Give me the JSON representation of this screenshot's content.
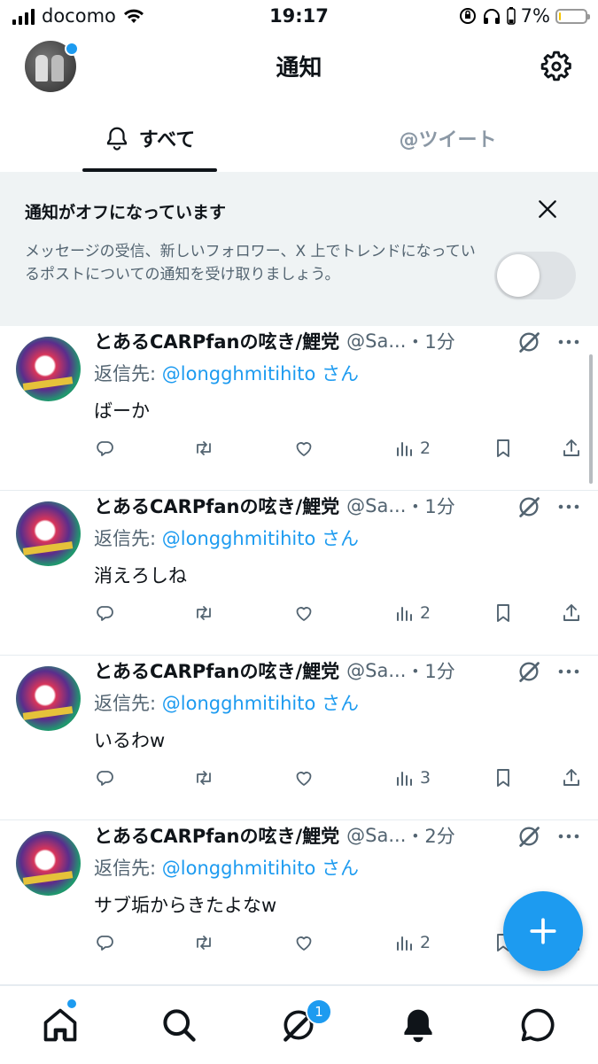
{
  "status_bar": {
    "carrier": "docomo",
    "time": "19:17",
    "battery": "7%",
    "battery_level": 0.07
  },
  "header": {
    "title": "通知"
  },
  "tabs": [
    {
      "label": "すべて",
      "active": true
    },
    {
      "label": "@ツイート",
      "active": false
    }
  ],
  "banner": {
    "title": "通知がオフになっています",
    "body": "メッセージの受信、新しいフォロワー、X 上でトレンドになっているポストについての通知を受け取りましょう。",
    "toggle_on": false
  },
  "posts": [
    {
      "name": "とあるCARPfanの呟き/鯉党",
      "handle": "@Sa...",
      "time": "・1分",
      "reply_prefix": "返信先: ",
      "reply_to": "@longghmitihito さん",
      "text": "ばーか",
      "views": "2"
    },
    {
      "name": "とあるCARPfanの呟き/鯉党",
      "handle": "@Sa...",
      "time": "・1分",
      "reply_prefix": "返信先: ",
      "reply_to": "@longghmitihito さん",
      "text": "消えろしね",
      "views": "2"
    },
    {
      "name": "とあるCARPfanの呟き/鯉党",
      "handle": "@Sa...",
      "time": "・1分",
      "reply_prefix": "返信先: ",
      "reply_to": "@longghmitihito さん",
      "text": "いるわw",
      "views": "3"
    },
    {
      "name": "とあるCARPfanの呟き/鯉党",
      "handle": "@Sa...",
      "time": "・2分",
      "reply_prefix": "返信先: ",
      "reply_to": "@longghmitihito さん",
      "text": "サブ垢からきたよなw",
      "views": "2"
    }
  ],
  "tabbar": {
    "grok_badge": "1"
  },
  "colors": {
    "accent": "#1d9bf0",
    "text": "#0f1419",
    "muted": "#536471",
    "banner_bg": "#eff3f4"
  },
  "icons": [
    "home-icon",
    "search-icon",
    "grok-icon",
    "bell-icon",
    "message-icon",
    "gear-icon",
    "close-icon",
    "compose-plus-icon"
  ]
}
